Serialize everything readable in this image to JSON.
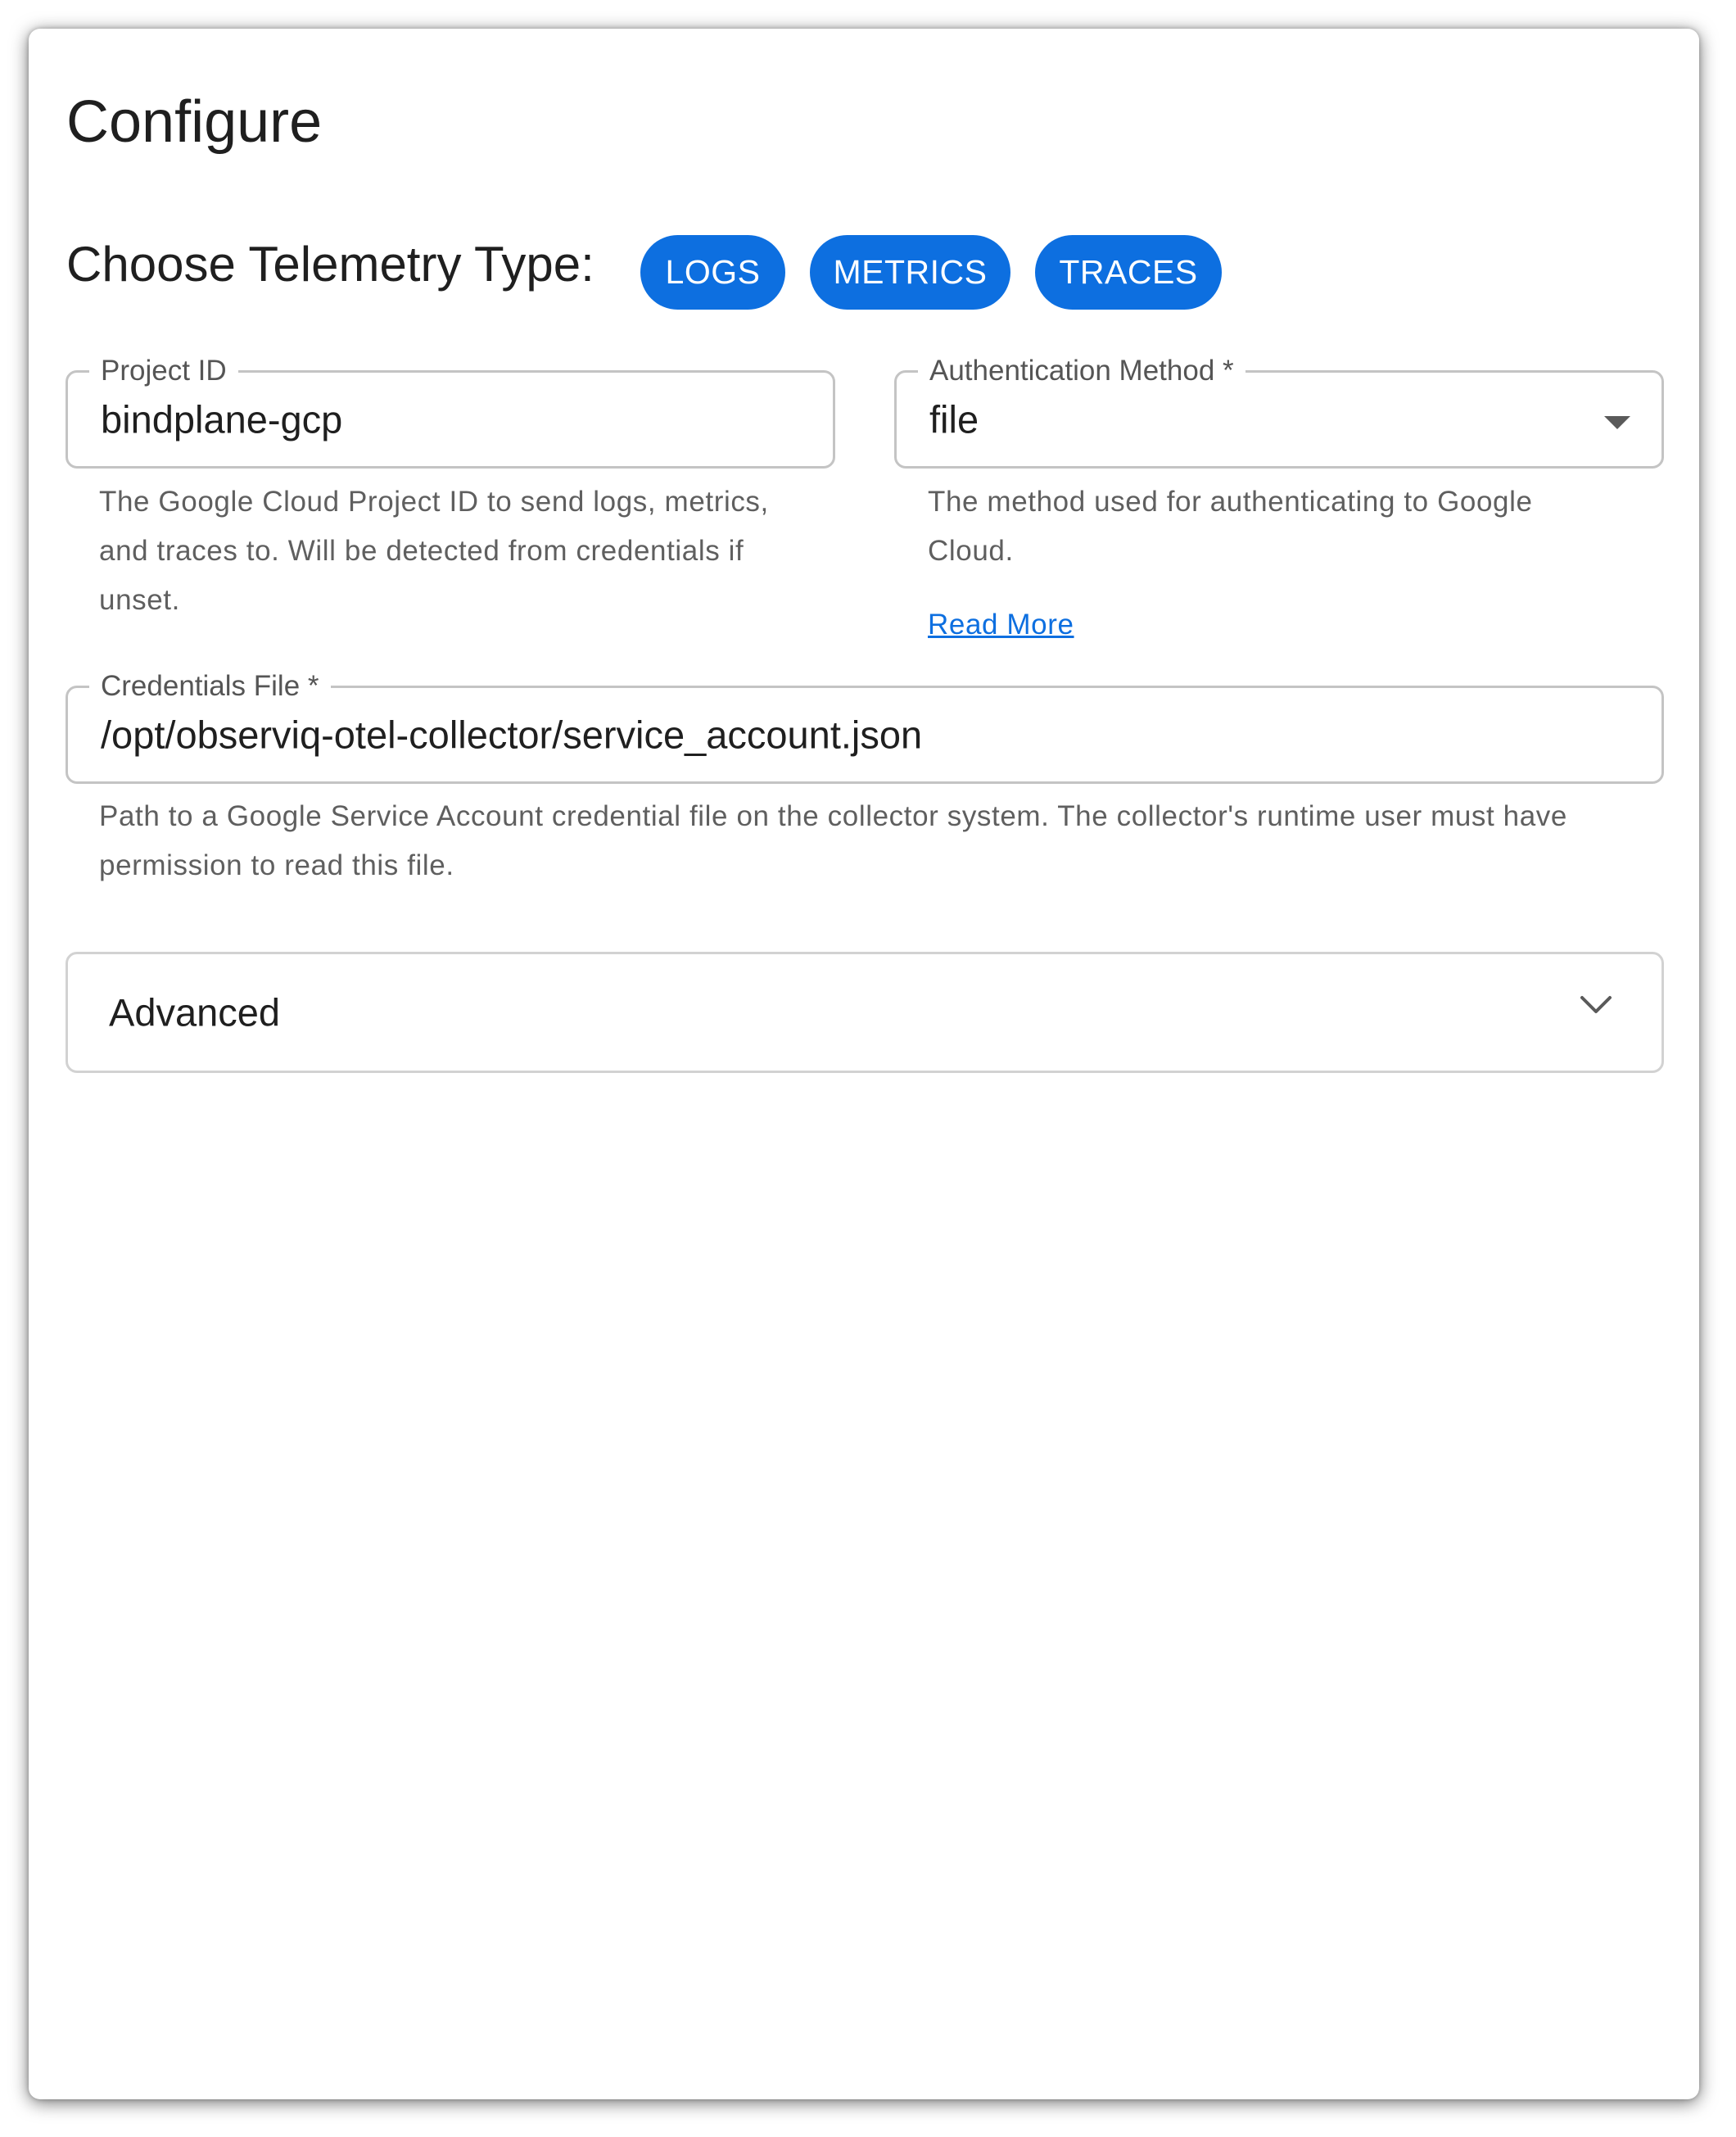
{
  "page": {
    "title": "Configure"
  },
  "telemetry": {
    "label": "Choose Telemetry Type:",
    "chips": [
      "LOGS",
      "METRICS",
      "TRACES"
    ]
  },
  "project_id": {
    "label": "Project ID",
    "value": "bindplane-gcp",
    "help": "The Google Cloud Project ID to send logs, metrics, and traces to. Will be detected from credentials if unset."
  },
  "auth_method": {
    "label": "Authentication Method *",
    "value": "file",
    "help": "The method used for authenticating to Google Cloud.",
    "link": "Read More"
  },
  "credentials_file": {
    "label": "Credentials File *",
    "value": "/opt/observiq-otel-collector/service_account.json",
    "help": "Path to a Google Service Account credential file on the collector system. The collector's runtime user must have permission to read this file."
  },
  "advanced": {
    "label": "Advanced",
    "icon": "chevron-down-icon"
  },
  "colors": {
    "accent": "#0d6fe0",
    "border": "#c4c4c4",
    "helper_text": "#5f5f5f"
  }
}
